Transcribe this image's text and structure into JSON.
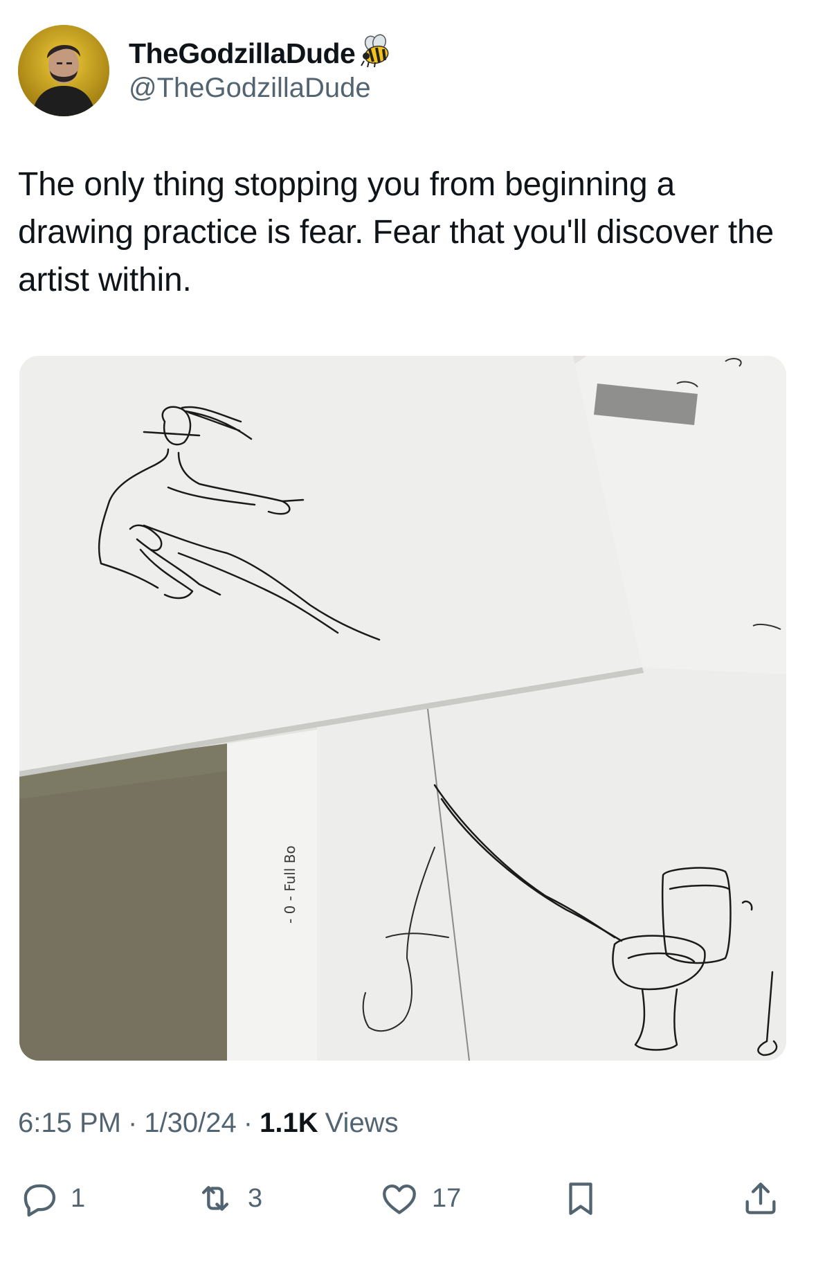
{
  "author": {
    "display_name": "TheGodzillaDude",
    "handle": "@TheGodzillaDude",
    "avatar_icon": "avatar-photo",
    "badge_icon": "bee-emoji"
  },
  "tweet": {
    "text": "The only thing stopping you from beginning a drawing practice is fear. Fear that you'll discover the artist within."
  },
  "media": {
    "sheet_label": "- 0 - Full Bo"
  },
  "meta": {
    "time": "6:15 PM",
    "separator": "·",
    "date": "1/30/24",
    "views_count": "1.1K",
    "views_label": "Views"
  },
  "actions": {
    "replies": "1",
    "retweets": "3",
    "likes": "17"
  },
  "colors": {
    "text_primary": "#0f1419",
    "text_secondary": "#536471",
    "avatar_ring": "#c9a21a"
  }
}
